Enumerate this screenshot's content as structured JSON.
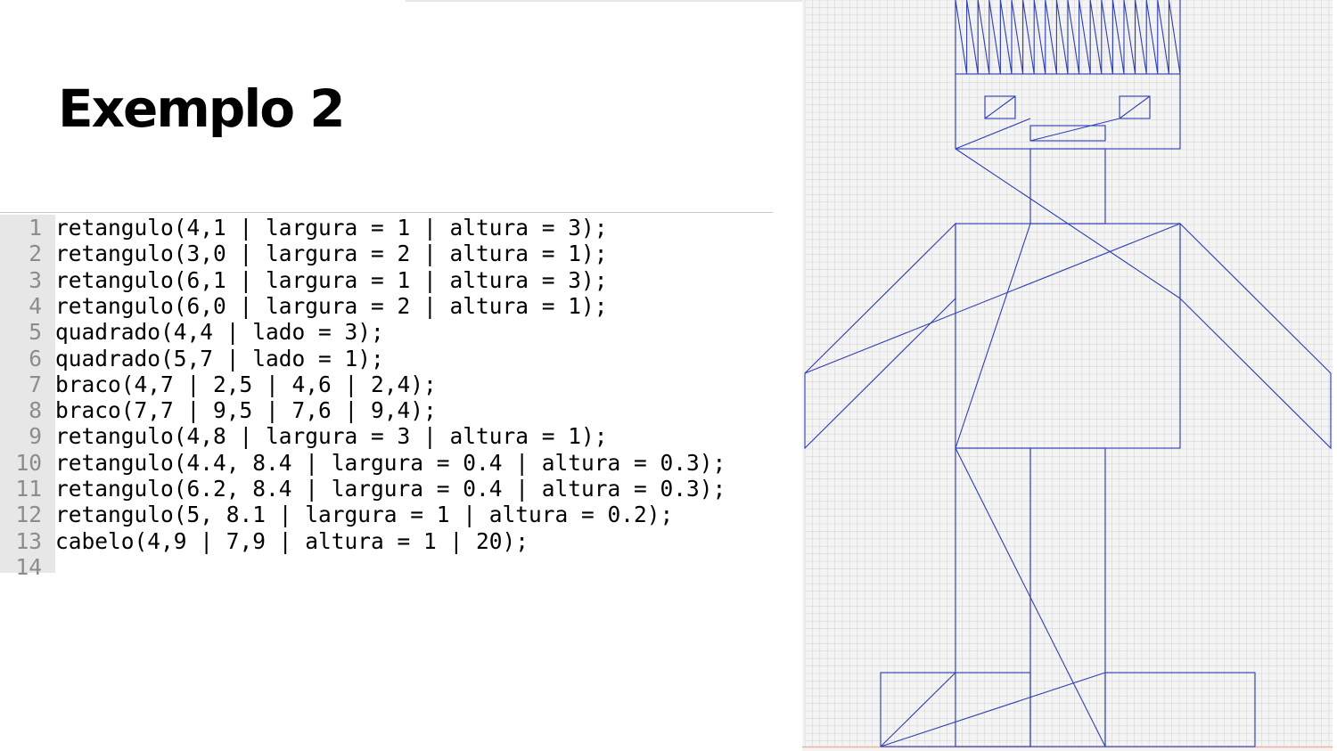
{
  "slide": {
    "title": "Exemplo 2"
  },
  "code_editor": {
    "lines": [
      {
        "num": "1",
        "text": "retangulo(4,1 | largura = 1 | altura = 3);"
      },
      {
        "num": "2",
        "text": "retangulo(3,0 | largura = 2 | altura = 1);"
      },
      {
        "num": "3",
        "text": "retangulo(6,1 | largura = 1 | altura = 3);"
      },
      {
        "num": "4",
        "text": "retangulo(6,0 | largura = 2 | altura = 1);"
      },
      {
        "num": "5",
        "text": "quadrado(4,4 | lado = 3);"
      },
      {
        "num": "6",
        "text": "quadrado(5,7 | lado = 1);"
      },
      {
        "num": "7",
        "text": "braco(4,7 | 2,5 | 4,6 | 2,4);"
      },
      {
        "num": "8",
        "text": "braco(7,7 | 9,5 | 7,6 | 9,4);"
      },
      {
        "num": "9",
        "text": "retangulo(4,8 | largura = 3 | altura = 1);"
      },
      {
        "num": "10",
        "text": "retangulo(4.4, 8.4 | largura = 0.4 | altura = 0.3);"
      },
      {
        "num": "11",
        "text": "retangulo(6.2, 8.4 | largura = 0.4 | altura = 0.3);"
      },
      {
        "num": "12",
        "text": "retangulo(5, 8.1 | largura = 1 | altura = 0.2);"
      },
      {
        "num": "13",
        "text": "cabelo(4,9 | 7,9 | altura = 1 | 20);"
      },
      {
        "num": "14",
        "text": ""
      }
    ]
  },
  "drawing": {
    "grid_color": "#d6d6d6",
    "line_color": "#2e3fb3",
    "baseline_color": "#e8b4a0"
  }
}
